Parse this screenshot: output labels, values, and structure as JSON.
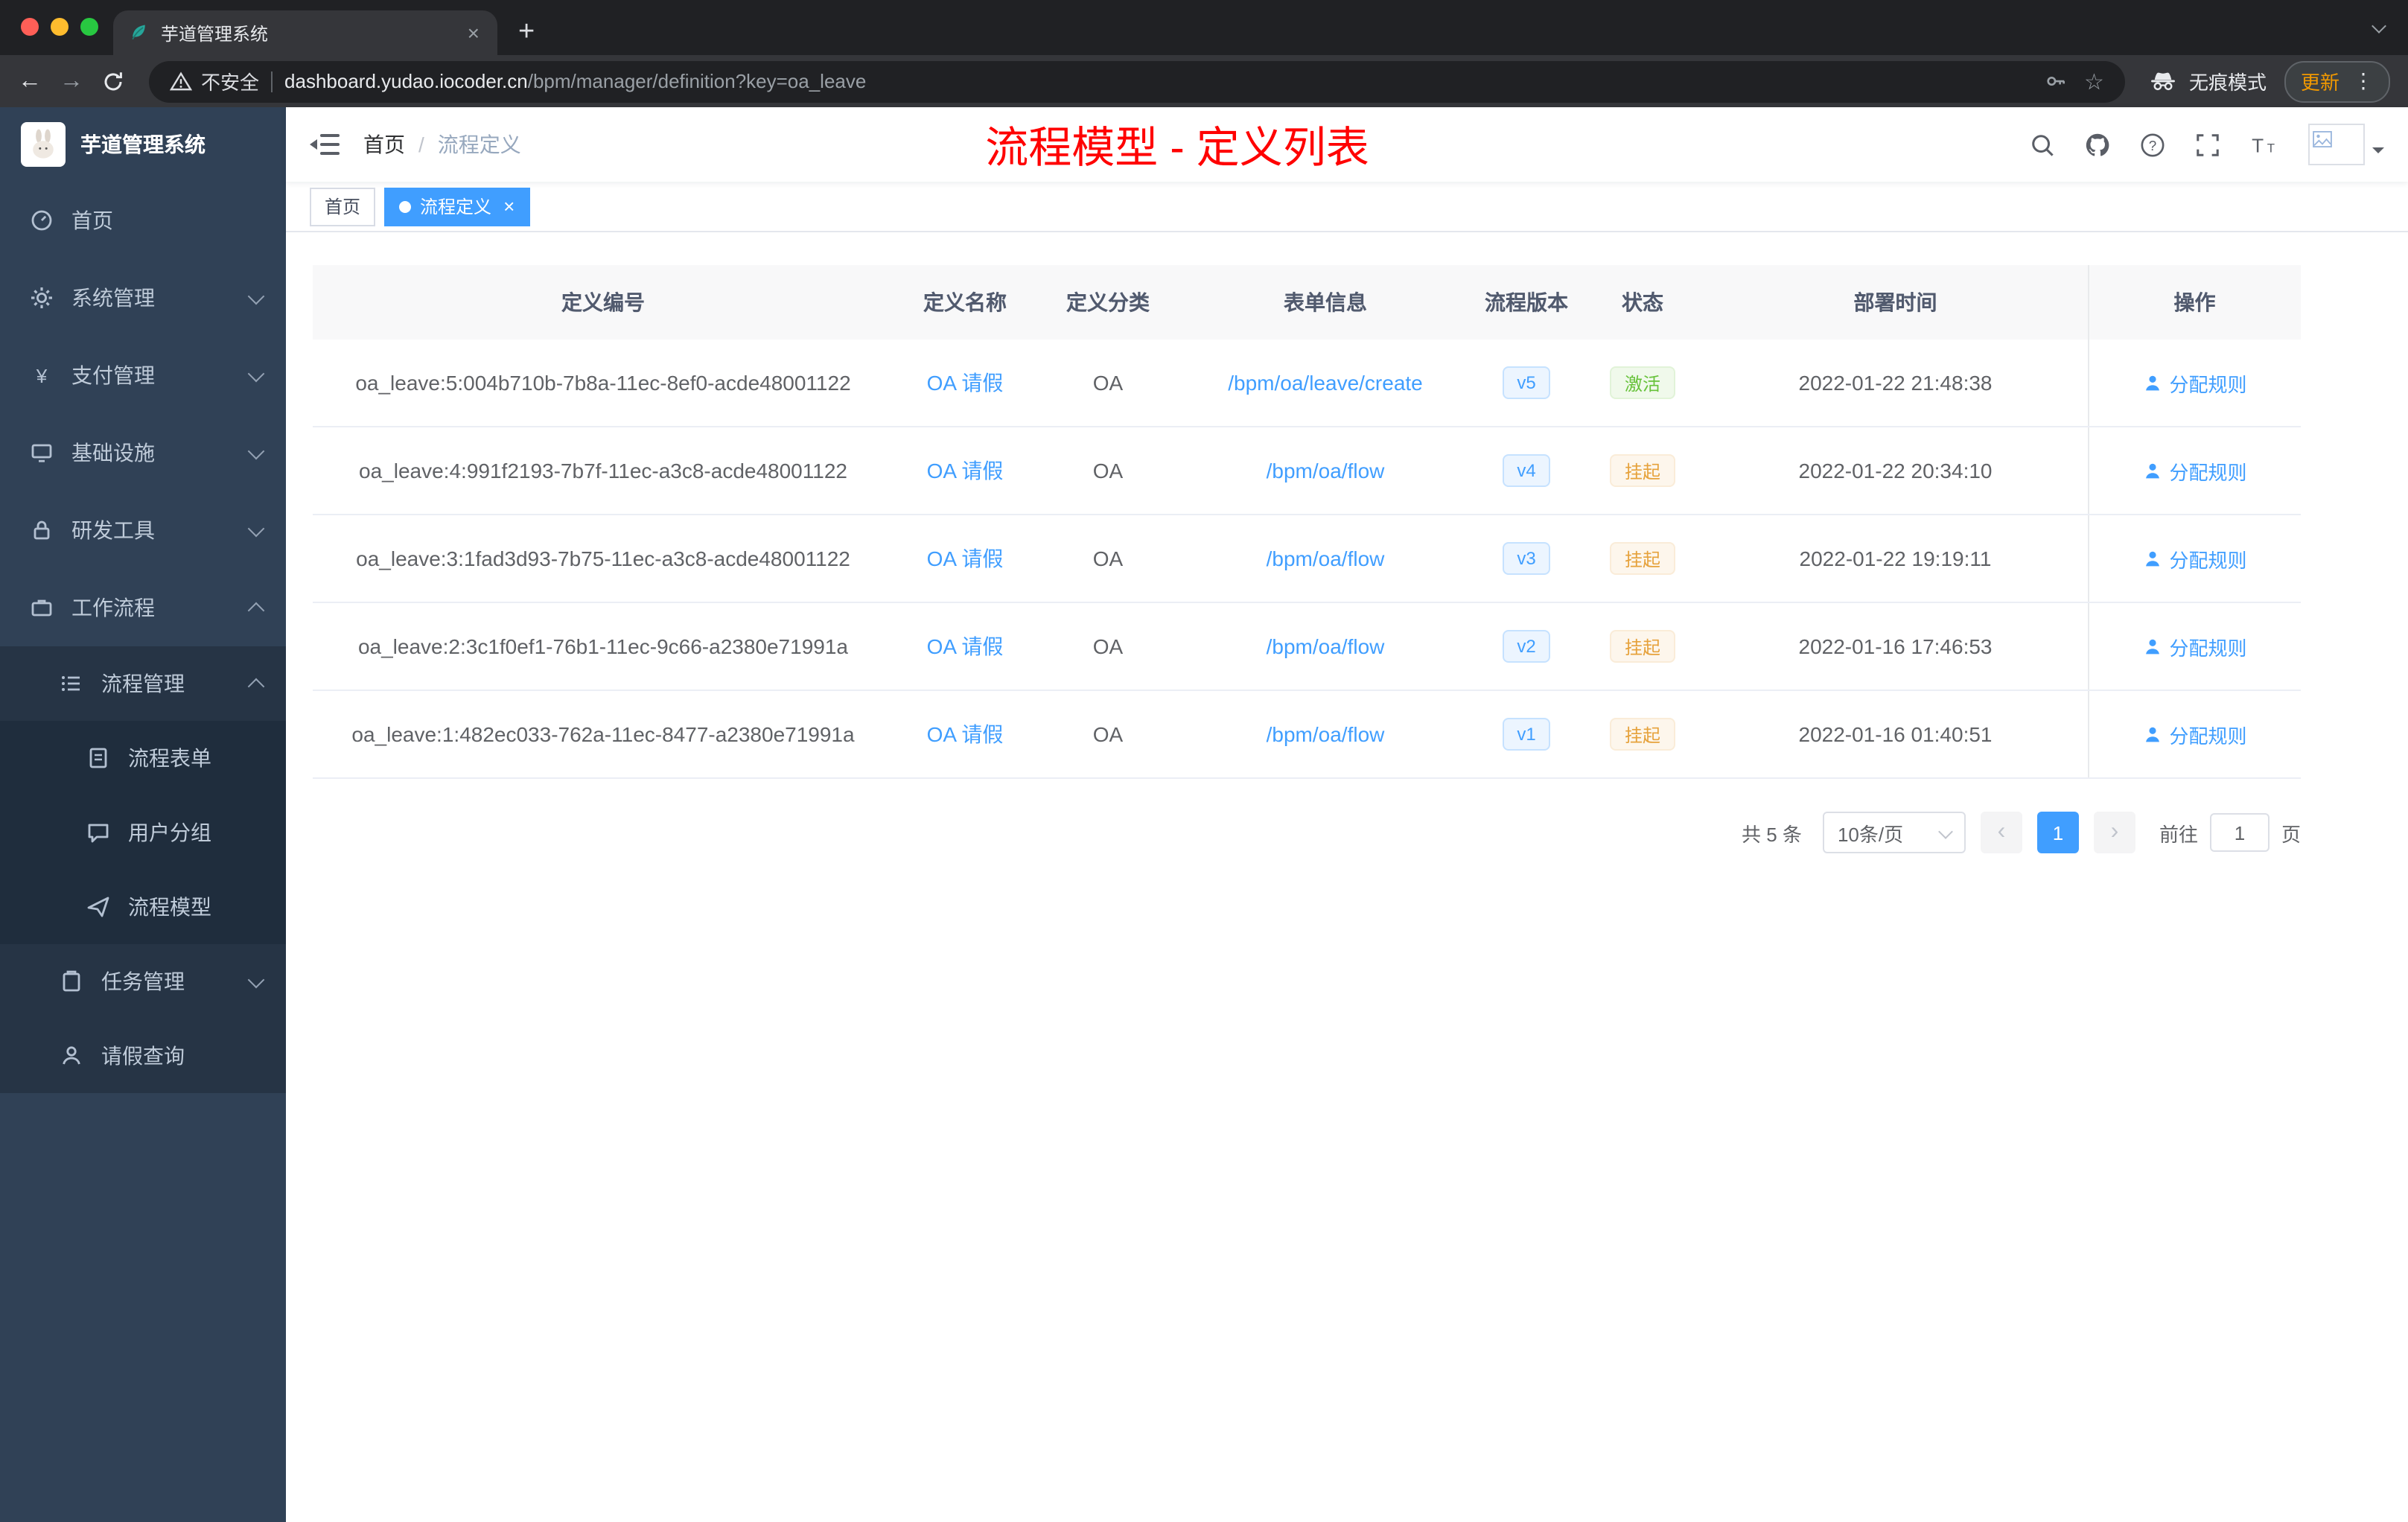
{
  "colors": {
    "primary": "#409eff",
    "success": "#67c23a",
    "warning": "#e6a23c",
    "overlay_red": "#ff0000",
    "sidebar_bg": "#304156"
  },
  "browser": {
    "tab_title": "芋道管理系统",
    "close_tab": "×",
    "new_tab_button": "+",
    "back": "←",
    "forward": "→",
    "security_label": "不安全",
    "url_host": "dashboard.yudao.iocoder.cn",
    "url_path": "/bpm/manager/definition?key=oa_leave",
    "star": "☆",
    "incognito_label": "无痕模式",
    "update_label": "更新",
    "menu_dots": "⋮"
  },
  "sidebar": {
    "logo_title": "芋道管理系统",
    "items": [
      {
        "slug": "home",
        "label": "首页",
        "icon": "dashboard",
        "level": 1,
        "chevron": null
      },
      {
        "slug": "system-management",
        "label": "系统管理",
        "icon": "gear",
        "level": 1,
        "chevron": "down"
      },
      {
        "slug": "payment-management",
        "label": "支付管理",
        "icon": "yen",
        "level": 1,
        "chevron": "down"
      },
      {
        "slug": "infrastructure",
        "label": "基础设施",
        "icon": "infra",
        "level": 1,
        "chevron": "down"
      },
      {
        "slug": "dev-tools",
        "label": "研发工具",
        "icon": "tools",
        "level": 1,
        "chevron": "down"
      },
      {
        "slug": "workflow",
        "label": "工作流程",
        "icon": "workflow",
        "level": 1,
        "chevron": "up"
      },
      {
        "slug": "process-management",
        "label": "流程管理",
        "icon": "list",
        "level": 2,
        "chevron": "up"
      },
      {
        "slug": "process-form",
        "label": "流程表单",
        "icon": "form",
        "level": 3,
        "chevron": null
      },
      {
        "slug": "user-group",
        "label": "用户分组",
        "icon": "group",
        "level": 3,
        "chevron": null
      },
      {
        "slug": "process-model",
        "label": "流程模型",
        "icon": "send",
        "level": 3,
        "chevron": null
      },
      {
        "slug": "task-management",
        "label": "任务管理",
        "icon": "task",
        "level": 2,
        "chevron": "down"
      },
      {
        "slug": "leave-query",
        "label": "请假查询",
        "icon": "user",
        "level": 2,
        "chevron": null
      }
    ]
  },
  "header": {
    "breadcrumb": [
      "首页",
      "流程定义"
    ],
    "breadcrumb_separator": "/",
    "overlay_title": "流程模型 - 定义列表"
  },
  "tags": {
    "home": "首页",
    "active_label": "流程定义",
    "close": "×"
  },
  "table": {
    "columns": [
      "定义编号",
      "定义名称",
      "定义分类",
      "表单信息",
      "流程版本",
      "状态",
      "部署时间",
      "操作"
    ],
    "rows": [
      {
        "id": "oa_leave:5:004b710b-7b8a-11ec-8ef0-acde48001122",
        "name": "OA 请假",
        "category": "OA",
        "form": "/bpm/oa/leave/create",
        "version": "v5",
        "status": "激活",
        "status_type": "success",
        "deployed": "2022-01-22 21:48:38",
        "action": "分配规则"
      },
      {
        "id": "oa_leave:4:991f2193-7b7f-11ec-a3c8-acde48001122",
        "name": "OA 请假",
        "category": "OA",
        "form": "/bpm/oa/flow",
        "version": "v4",
        "status": "挂起",
        "status_type": "warning",
        "deployed": "2022-01-22 20:34:10",
        "action": "分配规则"
      },
      {
        "id": "oa_leave:3:1fad3d93-7b75-11ec-a3c8-acde48001122",
        "name": "OA 请假",
        "category": "OA",
        "form": "/bpm/oa/flow",
        "version": "v3",
        "status": "挂起",
        "status_type": "warning",
        "deployed": "2022-01-22 19:19:11",
        "action": "分配规则"
      },
      {
        "id": "oa_leave:2:3c1f0ef1-76b1-11ec-9c66-a2380e71991a",
        "name": "OA 请假",
        "category": "OA",
        "form": "/bpm/oa/flow",
        "version": "v2",
        "status": "挂起",
        "status_type": "warning",
        "deployed": "2022-01-16 17:46:53",
        "action": "分配规则"
      },
      {
        "id": "oa_leave:1:482ec033-762a-11ec-8477-a2380e71991a",
        "name": "OA 请假",
        "category": "OA",
        "form": "/bpm/oa/flow",
        "version": "v1",
        "status": "挂起",
        "status_type": "warning",
        "deployed": "2022-01-16 01:40:51",
        "action": "分配规则"
      }
    ]
  },
  "pagination": {
    "total": "共 5 条",
    "page_size": "10条/页",
    "prev": "‹",
    "page": "1",
    "next": "›",
    "goto_label": "前往",
    "goto_value": "1",
    "unit_label": "页"
  }
}
